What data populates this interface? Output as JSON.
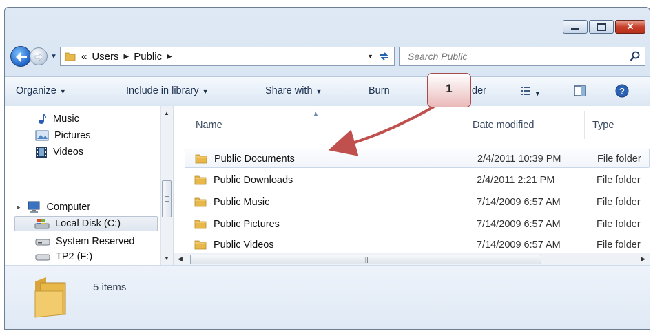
{
  "window": {
    "caption": {
      "minimize": "",
      "maximize": "",
      "close": "✕"
    }
  },
  "address_bar": {
    "overflow": "«",
    "crumbs": [
      "Users",
      "Public"
    ],
    "separator": "▶"
  },
  "search": {
    "placeholder": "Search Public"
  },
  "toolbar": {
    "items": [
      {
        "label": "Organize",
        "dropdown": true
      },
      {
        "label": "Include in library",
        "dropdown": true
      },
      {
        "label": "Share with",
        "dropdown": true
      },
      {
        "label": "Burn",
        "dropdown": false
      },
      {
        "label": "der",
        "dropdown": false
      }
    ]
  },
  "nav_pane": {
    "items": [
      {
        "label": "Music",
        "icon": "music-icon"
      },
      {
        "label": "Pictures",
        "icon": "pictures-icon"
      },
      {
        "label": "Videos",
        "icon": "videos-icon"
      },
      {
        "label": "Computer",
        "icon": "computer-icon"
      },
      {
        "label": "Local Disk (C:)",
        "icon": "local-disk-icon"
      },
      {
        "label": "System Reserved",
        "icon": "drive-icon"
      },
      {
        "label": "TP2 (F:)",
        "icon": "drive-icon"
      }
    ]
  },
  "file_list": {
    "columns": [
      "Name",
      "Date modified",
      "Type"
    ],
    "rows": [
      {
        "name": "Public Documents",
        "date": "2/4/2011 10:39 PM",
        "type": "File folder"
      },
      {
        "name": "Public Downloads",
        "date": "2/4/2011 2:21 PM",
        "type": "File folder"
      },
      {
        "name": "Public Music",
        "date": "7/14/2009 6:57 AM",
        "type": "File folder"
      },
      {
        "name": "Public Pictures",
        "date": "7/14/2009 6:57 AM",
        "type": "File folder"
      },
      {
        "name": "Public Videos",
        "date": "7/14/2009 6:57 AM",
        "type": "File folder"
      }
    ]
  },
  "details": {
    "count": "5 items"
  },
  "callout": {
    "label": "1"
  },
  "colors": {
    "callout_border": "#a64a4a",
    "arrow": "#c0504d",
    "folder": "#e8b84a"
  }
}
